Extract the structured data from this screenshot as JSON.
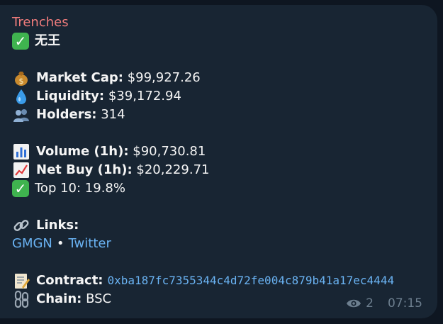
{
  "message": {
    "sender": "Trenches",
    "token_name": "无王",
    "market_cap_label": "Market Cap:",
    "market_cap_value": "$99,927.26",
    "liquidity_label": "Liquidity:",
    "liquidity_value": "$39,172.94",
    "holders_label": "Holders:",
    "holders_value": "314",
    "volume_label": "Volume (1h):",
    "volume_value": "$90,730.81",
    "net_buy_label": "Net Buy (1h):",
    "net_buy_value": "$20,229.71",
    "top10_text": "Top 10: 19.8%",
    "links_label": "Links:",
    "link_gmgn": "GMGN",
    "link_sep": "•",
    "link_twitter": "Twitter",
    "contract_label": "Contract:",
    "contract_value": "0xba187fc7355344c4d72fe004c879b41a17ec4444",
    "chain_label": "Chain:",
    "chain_value": "BSC",
    "views": "2",
    "time": "07:15"
  },
  "icons": {
    "check": "check-mark-icon",
    "money_bag": "money-bag-icon",
    "droplet": "droplet-icon",
    "people": "people-icon",
    "bar_chart": "bar-chart-icon",
    "trend_up": "chart-increasing-icon",
    "link": "link-icon",
    "memo": "memo-icon",
    "chains": "chains-icon",
    "eye": "eye-icon"
  },
  "colors": {
    "background": "#0e1621",
    "bubble": "#182533",
    "sender": "#f07c7c",
    "link": "#6ab3f3",
    "meta": "#6d7f8f",
    "check": "#3fb34f"
  }
}
